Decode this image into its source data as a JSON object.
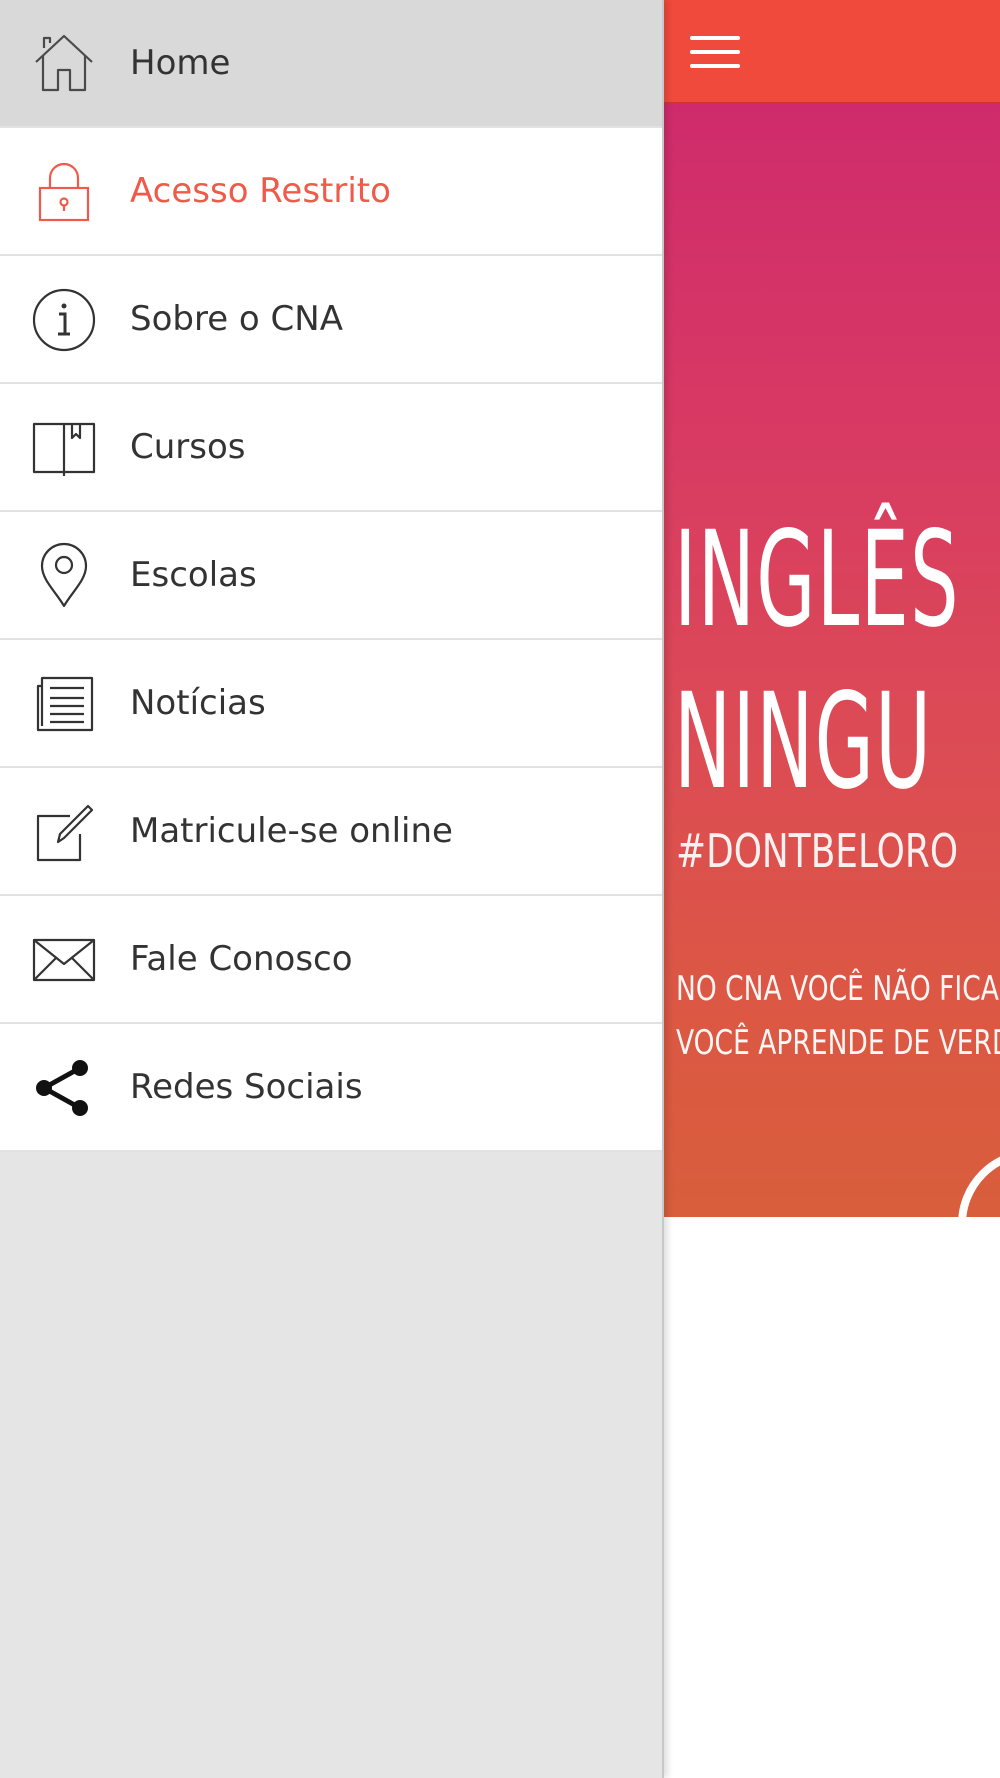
{
  "colors": {
    "accent": "#f04a3c",
    "highlight_text": "#f05a4a",
    "drawer_background": "#e5e5e5"
  },
  "app_bar": {
    "menu_icon": "hamburger-menu-icon"
  },
  "banner": {
    "headline_line1": "INGLÊS",
    "headline_line2": "NINGU",
    "hashtag": "#DONTBELORO",
    "sub_line1": "NO CNA VOCÊ NÃO FICA",
    "sub_line2": "VOCÊ APRENDE DE VERDAD"
  },
  "drawer": {
    "items": [
      {
        "label": "Home",
        "icon": "home-icon"
      },
      {
        "label": "Acesso Restrito",
        "icon": "lock-icon"
      },
      {
        "label": "Sobre o CNA",
        "icon": "info-icon"
      },
      {
        "label": "Cursos",
        "icon": "book-icon"
      },
      {
        "label": "Escolas",
        "icon": "map-pin-icon"
      },
      {
        "label": "Notícias",
        "icon": "newspaper-icon"
      },
      {
        "label": "Matricule-se online",
        "icon": "edit-form-icon"
      },
      {
        "label": "Fale Conosco",
        "icon": "envelope-icon"
      },
      {
        "label": "Redes Sociais",
        "icon": "share-icon"
      }
    ]
  }
}
